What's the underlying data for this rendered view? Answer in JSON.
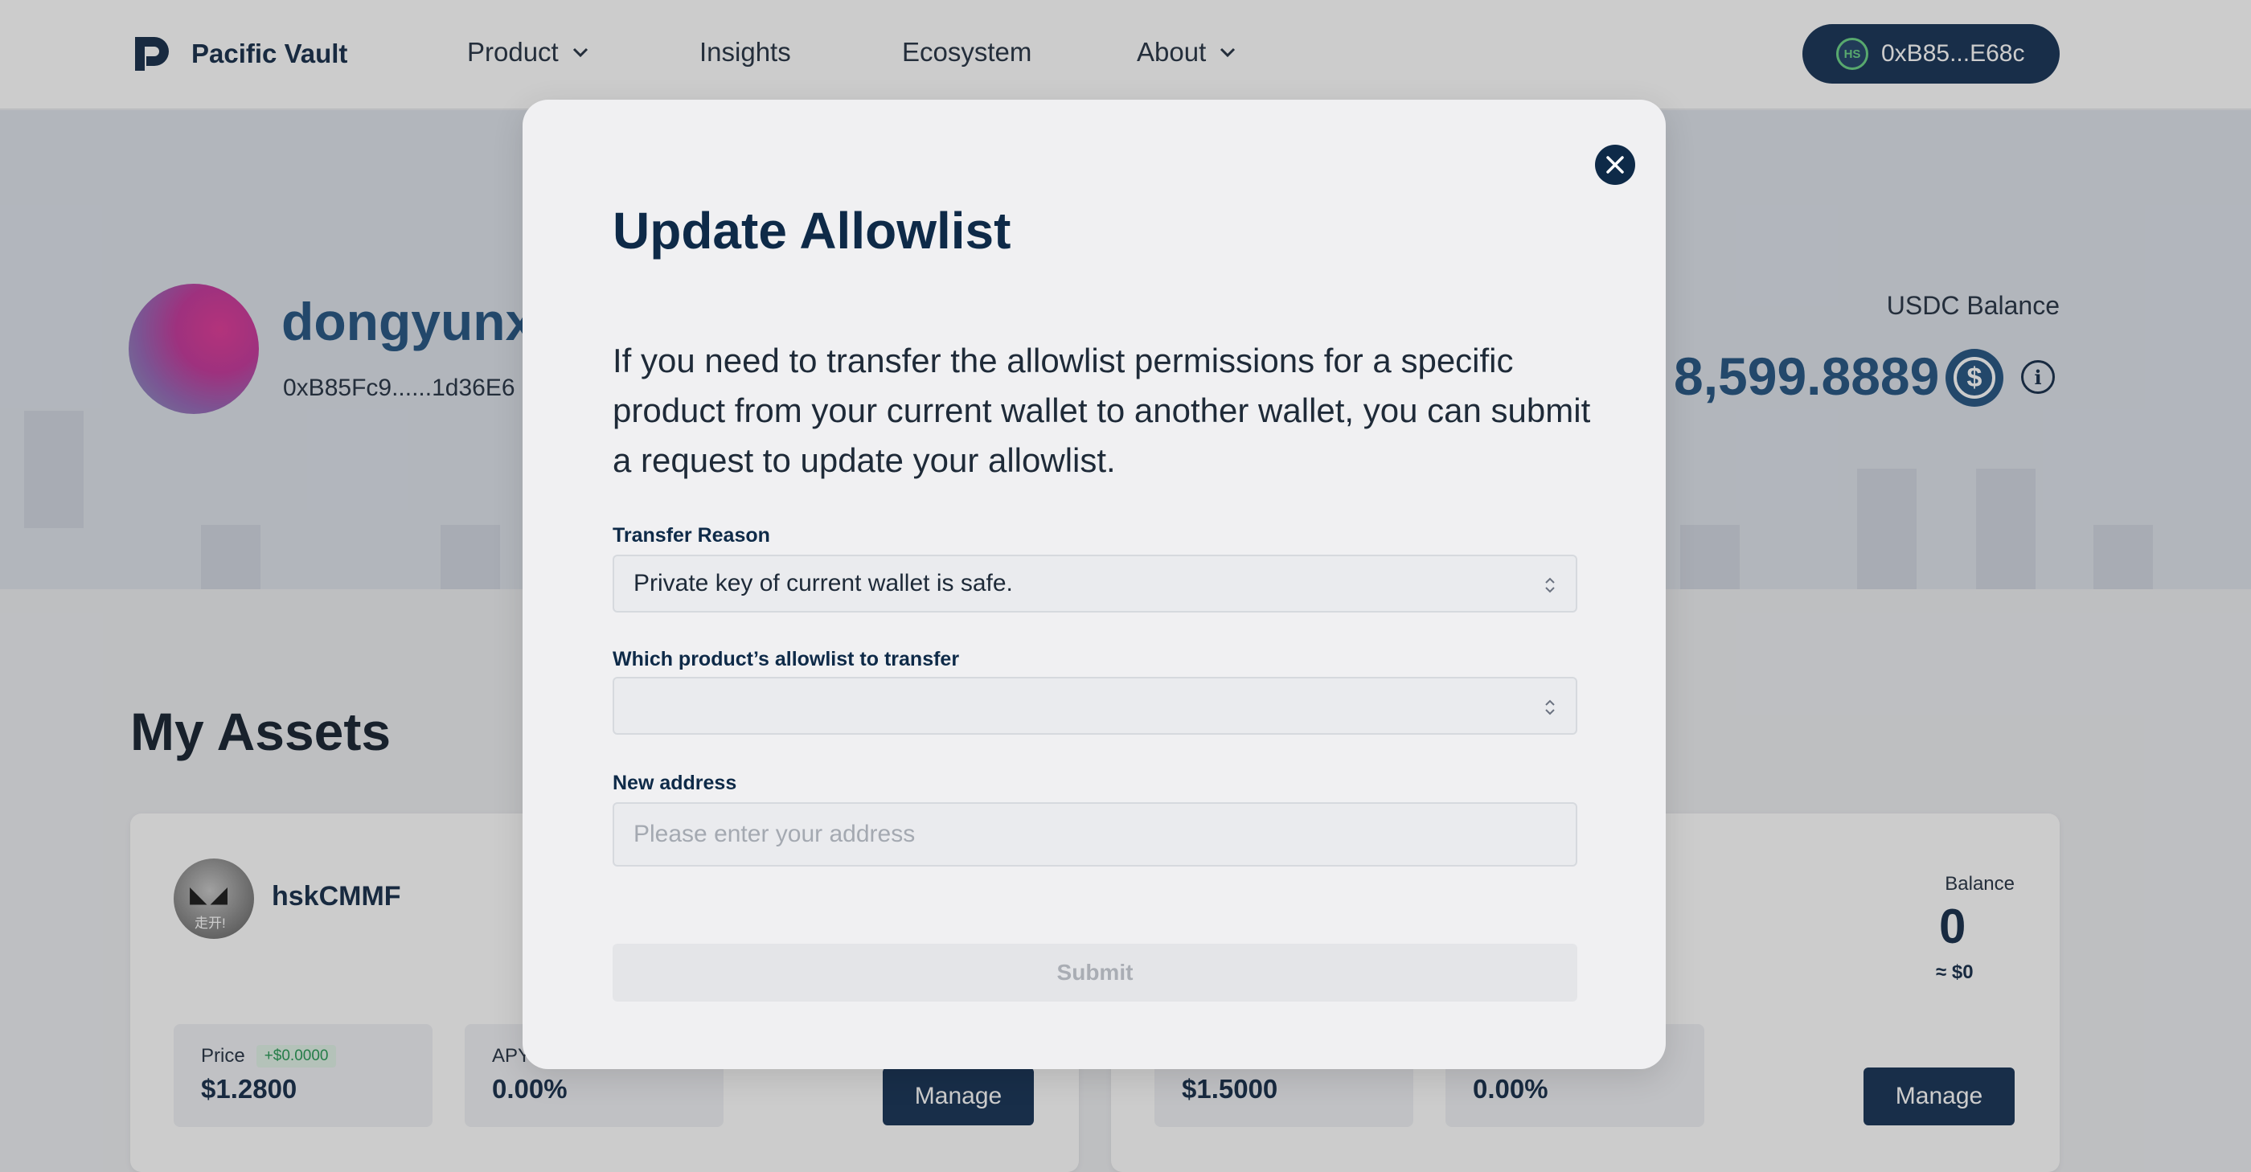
{
  "nav": {
    "brand": "Pacific Vault",
    "items": [
      {
        "label": "Product",
        "has_dropdown": true
      },
      {
        "label": "Insights",
        "has_dropdown": false
      },
      {
        "label": "Ecosystem",
        "has_dropdown": false
      },
      {
        "label": "About",
        "has_dropdown": true
      }
    ],
    "wallet_badge": "HS",
    "wallet_address": "0xB85...E68c"
  },
  "profile": {
    "username": "dongyunx",
    "address": "0xB85Fc9......1d36E6",
    "usdc_label": "USDC Balance",
    "usdc_value": "8,599.8889",
    "usdc_icon": "$"
  },
  "assets": {
    "title": "My Assets",
    "cards": [
      {
        "token_name": "hskCMMF",
        "token_ribbon": "走开!",
        "price_label": "Price",
        "price_delta": "+$0.0000",
        "price_value": "$1.2800",
        "apy_label": "APY",
        "apy_value": "0.00%",
        "manage_label": "Manage"
      },
      {
        "price_value": "$1.5000",
        "apy_value": "0.00%",
        "balance_label": "Balance",
        "balance_value": "0",
        "balance_usd": "≈ $0",
        "manage_label": "Manage"
      }
    ]
  },
  "modal": {
    "title": "Update Allowlist",
    "description": "If you need to transfer the allowlist permissions for a specific product from your current wallet to another wallet, you can submit a request to update your allowlist.",
    "transfer_reason_label": "Transfer Reason",
    "transfer_reason_value": "Private key of current wallet is safe.",
    "product_label": "Which product’s allowlist to transfer",
    "product_value": "",
    "new_address_label": "New address",
    "new_address_placeholder": "Please enter your address",
    "submit_label": "Submit"
  },
  "colors": {
    "brand_navy": "#1f3a5c",
    "modal_title": "#0e2a48",
    "accent_blue": "#2c5a86",
    "positive_green": "#2e9c5a"
  }
}
